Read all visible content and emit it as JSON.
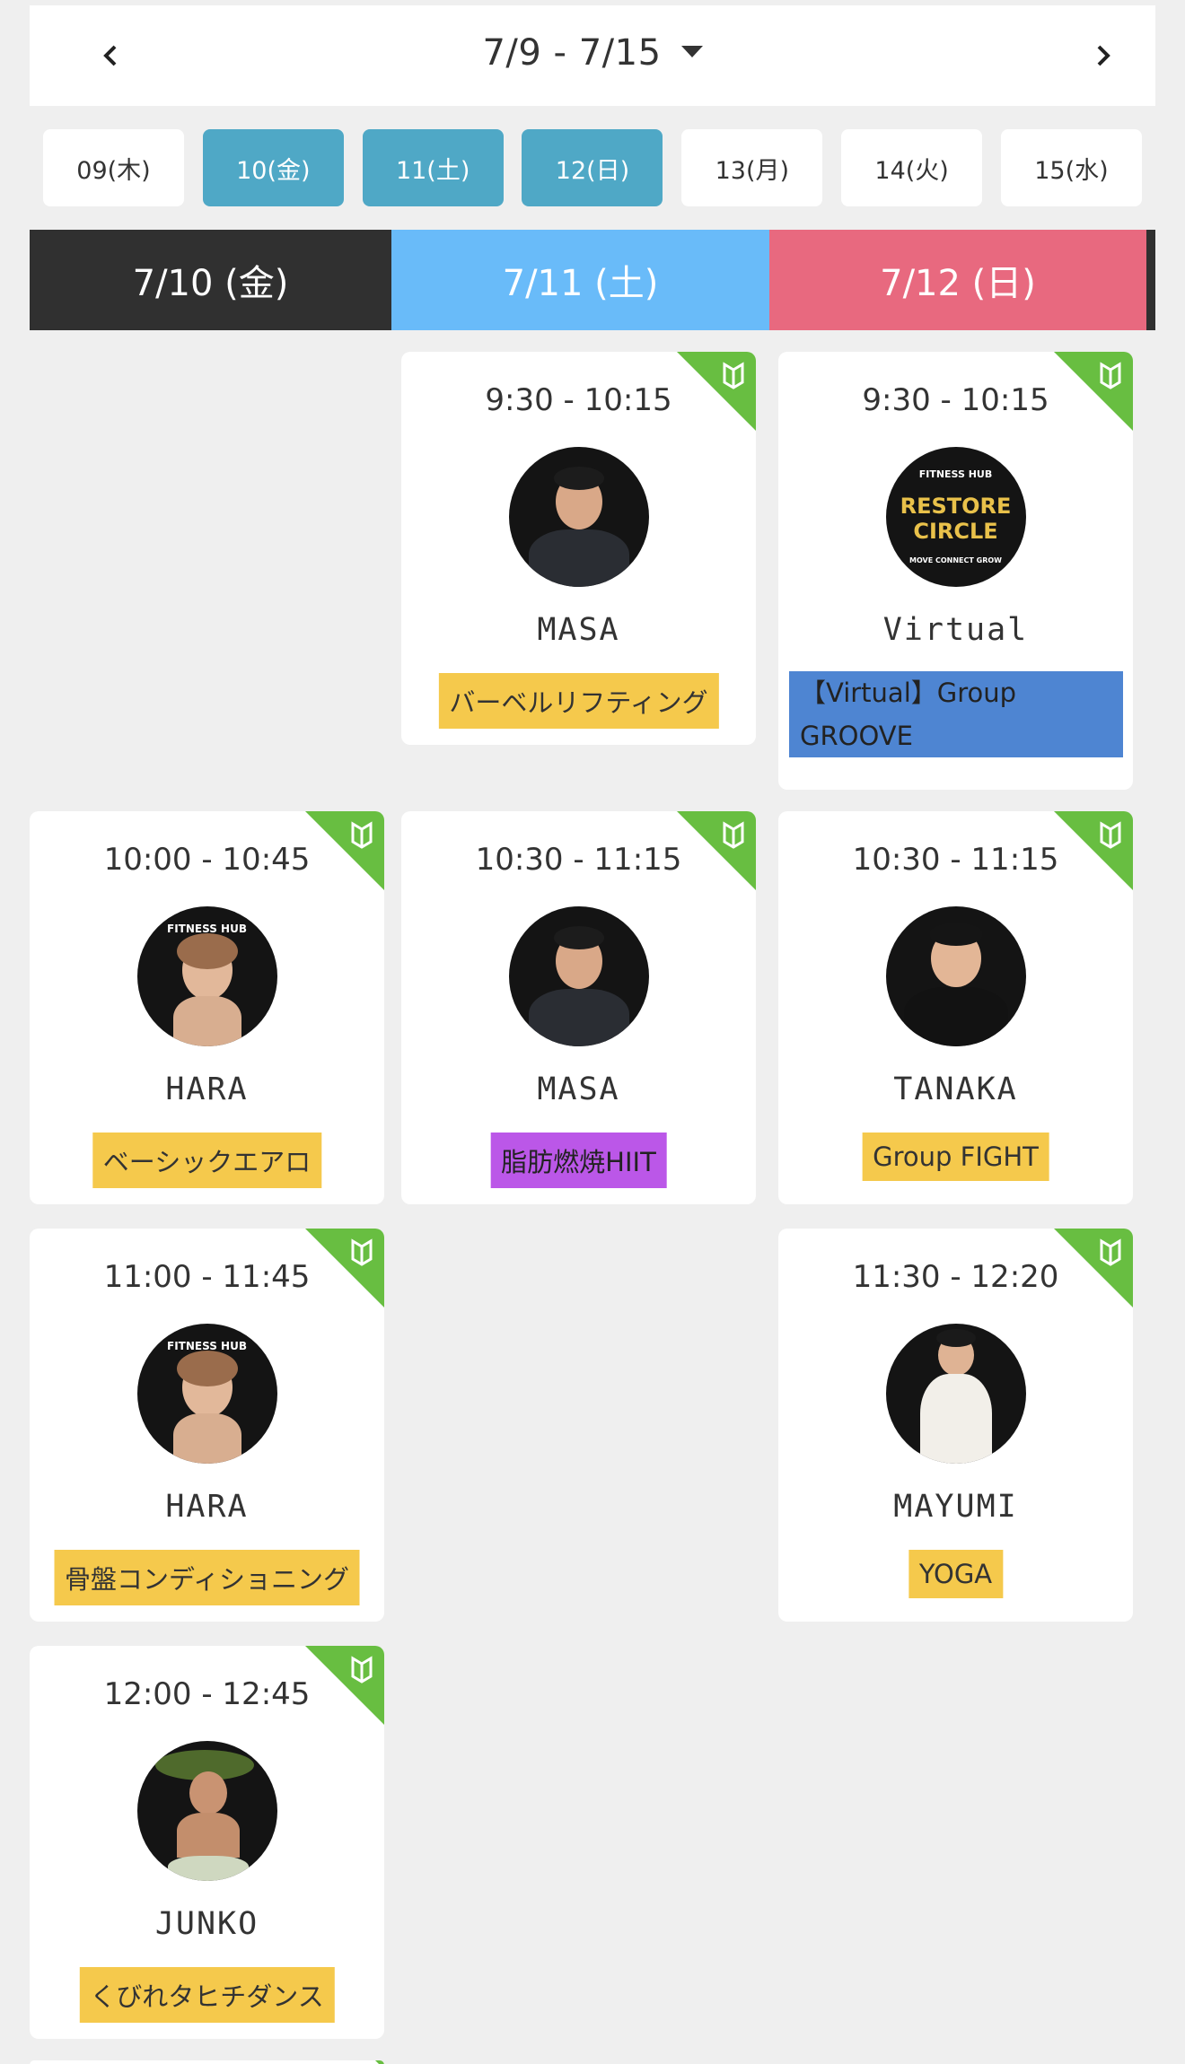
{
  "week": {
    "label": "7/9 - 7/15"
  },
  "day_pills": [
    {
      "label": "09(木)",
      "active": false
    },
    {
      "label": "10(金)",
      "active": true
    },
    {
      "label": "11(土)",
      "active": true
    },
    {
      "label": "12(日)",
      "active": true
    },
    {
      "label": "13(月)",
      "active": false
    },
    {
      "label": "14(火)",
      "active": false
    },
    {
      "label": "15(水)",
      "active": false
    }
  ],
  "day_headers": [
    "7/10 (金)",
    "7/11 (土)",
    "7/12 (日)"
  ],
  "colors": {
    "beginner_badge": "#68be41",
    "active_pill": "#4fa8c6",
    "saturday": "#69bbf9",
    "sunday": "#e8697f",
    "friday": "#303030"
  },
  "studio_logo": {
    "line1": "FITNESS HUB",
    "line2": "RESTORE",
    "line3": "CIRCLE",
    "line4": "MOVE CONNECT GROW"
  },
  "classes": [
    {
      "time": "9:30 - 10:15",
      "instructor": "MASA",
      "class_name": "バーベルリフティング",
      "tag_color": "yellow",
      "beginner": true
    },
    {
      "time": "9:30 - 10:15",
      "instructor": "Virtual",
      "class_name": "【Virtual】Group GROOVE",
      "tag_color": "blue",
      "beginner": true
    },
    {
      "time": "10:00 - 10:45",
      "instructor": "HARA",
      "class_name": "ベーシックエアロ",
      "tag_color": "yellow",
      "beginner": true
    },
    {
      "time": "10:30 - 11:15",
      "instructor": "MASA",
      "class_name": "脂肪燃焼HIIT",
      "tag_color": "purple",
      "beginner": true
    },
    {
      "time": "10:30 - 11:15",
      "instructor": "TANAKA",
      "class_name": "Group FIGHT",
      "tag_color": "yellow",
      "beginner": true
    },
    {
      "time": "11:00 - 11:45",
      "instructor": "HARA",
      "class_name": "骨盤コンディショニング",
      "tag_color": "yellow",
      "beginner": true
    },
    {
      "time": "11:30 - 12:20",
      "instructor": "MAYUMI",
      "class_name": "YOGA",
      "tag_color": "yellow",
      "beginner": true
    },
    {
      "time": "12:00 - 12:45",
      "instructor": "JUNKO",
      "class_name": "くびれタヒチダンス",
      "tag_color": "yellow",
      "beginner": true
    }
  ]
}
